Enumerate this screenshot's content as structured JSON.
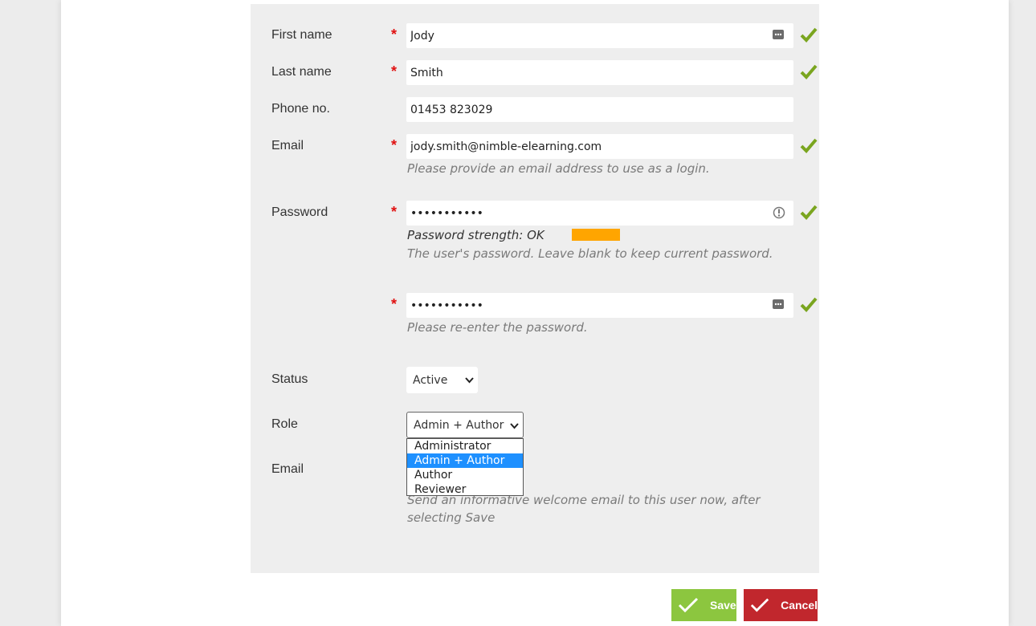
{
  "form": {
    "first_name": {
      "label": "First name",
      "value": "Jody"
    },
    "last_name": {
      "label": "Last name",
      "value": "Smith"
    },
    "phone": {
      "label": "Phone no.",
      "value": "01453 823029"
    },
    "email": {
      "label": "Email",
      "value": "jody.smith@nimble-elearning.com",
      "hint": "Please provide an email address to use as a login."
    },
    "password": {
      "label": "Password",
      "value": "•••••••••••",
      "strength_label": "Password strength: OK",
      "strength_level": "OK",
      "hint": "The user's password. Leave blank to keep current password."
    },
    "password_confirm": {
      "value": "•••••••••••",
      "hint": "Please re-enter the password."
    },
    "status": {
      "label": "Status",
      "value": "Active"
    },
    "role": {
      "label": "Role",
      "value": "Admin + Author",
      "options": [
        "Administrator",
        "Admin + Author",
        "Author",
        "Reviewer"
      ],
      "selected_index": 1
    },
    "welcome_email": {
      "label": "Email",
      "hint_line1": "Send an informative welcome email to this user now, after",
      "hint_line2": "selecting Save"
    }
  },
  "required_marker": "*",
  "buttons": {
    "save": "Save",
    "cancel": "Cancel"
  },
  "icons": {
    "valid": "check-icon",
    "field_menu": "ellipsis-icon",
    "password_reveal": "reveal-password-icon",
    "select": "chevron-down-icon"
  },
  "colors": {
    "valid_check": "#7aa51f",
    "required": "#e01010",
    "strength_ok": "#ffa500",
    "save_button": "#8cc63f",
    "cancel_button": "#c1272d",
    "selected_option": "#1e90ff",
    "panel_background": "#eeeeee"
  }
}
